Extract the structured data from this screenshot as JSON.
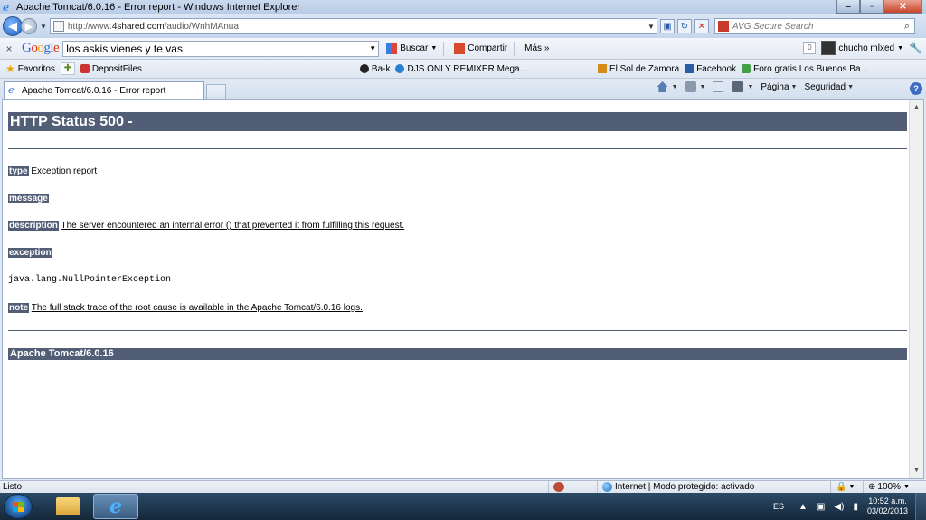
{
  "window": {
    "title": "Apache Tomcat/6.0.16 - Error report - Windows Internet Explorer"
  },
  "address_bar": {
    "url_prefix": "http://www.",
    "url_domain": "4shared.com",
    "url_path": "/audio/WnhMAnua",
    "search_placeholder": "AVG Secure Search"
  },
  "google_toolbar": {
    "search_value": "los askis vienes y te vas",
    "buscar_label": "Buscar",
    "compartir_label": "Compartir",
    "mas_label": "Más »",
    "notification_count": "0",
    "user_name": "chucho mlxed"
  },
  "favorites_bar": {
    "label": "Favoritos",
    "items": [
      {
        "label": "DepositFiles",
        "icon": "depositfiles-icon"
      },
      {
        "label": "Ba-k",
        "icon": "bak-icon"
      },
      {
        "label": "DJS ONLY REMIXER Mega...",
        "icon": "djs-icon"
      },
      {
        "label": "El Sol de Zamora",
        "icon": "sol-icon"
      },
      {
        "label": "Facebook",
        "icon": "facebook-icon"
      },
      {
        "label": "Foro gratis  Los Buenos Ba...",
        "icon": "foro-icon"
      }
    ]
  },
  "tab_bar": {
    "active_tab": "Apache Tomcat/6.0.16 - Error report",
    "pagina_label": "Página",
    "seguridad_label": "Seguridad"
  },
  "page": {
    "heading": "HTTP Status 500 -",
    "type_label": "type",
    "type_value": "Exception report",
    "message_label": "message",
    "description_label": "description",
    "description_value": "The server encountered an internal error () that prevented it from fulfilling this request.",
    "exception_label": "exception",
    "exception_value": "java.lang.NullPointerException",
    "note_label": "note",
    "note_value": "The full stack trace of the root cause is available in the Apache Tomcat/6.0.16 logs.",
    "footer": "Apache Tomcat/6.0.16"
  },
  "status_bar": {
    "status": "Listo",
    "zone": "Internet | Modo protegido: activado",
    "zoom": "100%"
  },
  "taskbar": {
    "language": "ES",
    "time": "10:52 a.m.",
    "date": "03/02/2013"
  },
  "colors": {
    "tomcat_header": "#525d76",
    "taskbar": "#1d3349"
  }
}
